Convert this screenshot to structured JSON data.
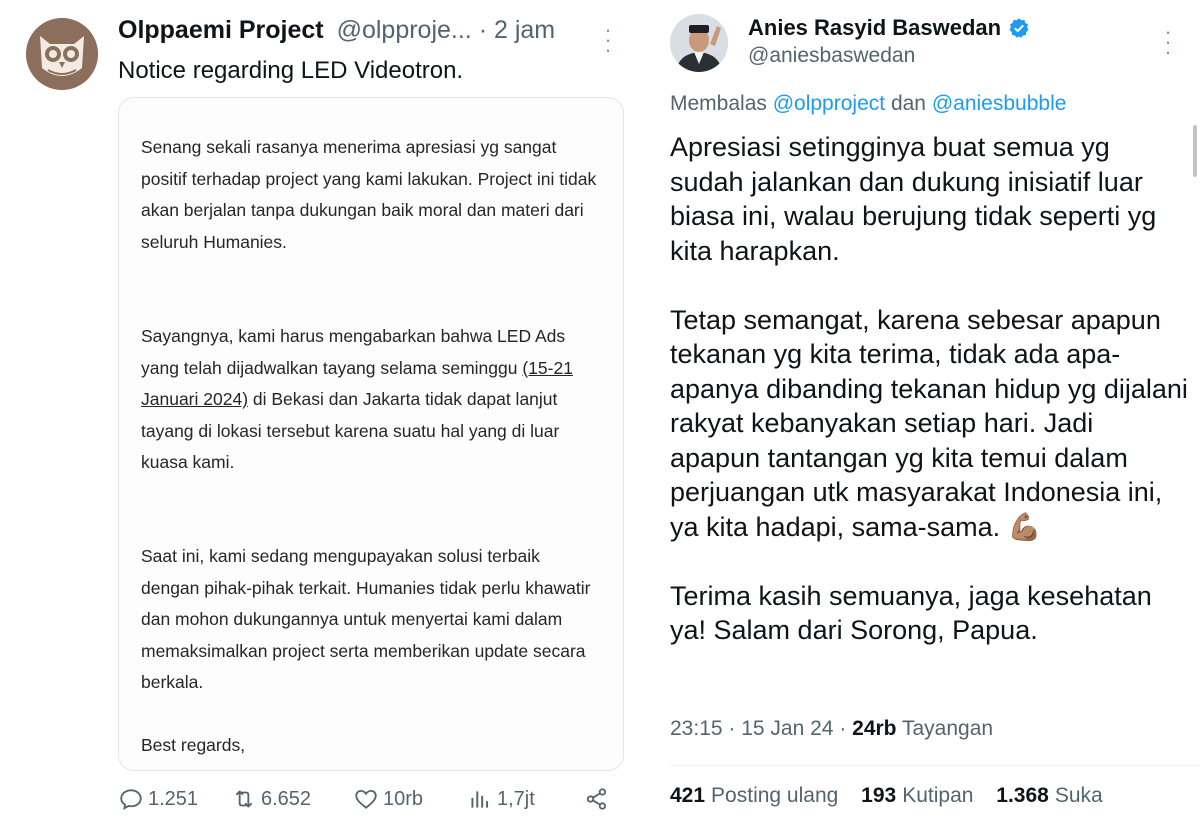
{
  "left_tweet": {
    "author_name": "Olppaemi Project",
    "handle": "@olpproje...",
    "time": "· 2 jam",
    "text": "Notice regarding LED Videotron.",
    "card": {
      "p1": "Senang sekali rasanya menerima apresiasi yg sangat positif terhadap project yang kami lakukan. Project ini tidak akan berjalan tanpa dukungan baik moral dan materi dari seluruh Humanies.",
      "p2_before": "Sayangnya, kami harus mengabarkan bahwa LED Ads yang telah dijadwalkan tayang selama seminggu ",
      "p2_date": "(15-21 Januari 2024)",
      "p2_after": " di Bekasi dan Jakarta tidak dapat lanjut tayang di lokasi tersebut karena suatu hal yang di luar kuasa kami.",
      "p3": "Saat ini, kami sedang mengupayakan solusi terbaik dengan pihak-pihak terkait. Humanies tidak perlu khawatir dan mohon dukungannya untuk menyertai kami dalam memaksimalkan project serta memberikan update secara berkala.",
      "p4": "Best regards,"
    },
    "actions": {
      "replies": "1.251",
      "reposts": "6.652",
      "likes": "10rb",
      "views": "1,7jt"
    }
  },
  "right_tweet": {
    "author_name": "Anies Rasyid Baswedan",
    "handle": "@aniesbaswedan",
    "reply_prefix": "Membalas",
    "reply_mention_1": "@olpproject",
    "reply_joiner": "dan",
    "reply_mention_2": "@aniesbubble",
    "body": [
      "Apresiasi setingginya buat semua yg sudah jalankan dan dukung inisiatif luar biasa ini, walau berujung tidak seperti yg kita harapkan.",
      "Tetap semangat, karena sebesar apapun tekanan yg kita terima, tidak ada apa-apanya dibanding tekanan hidup yg dijalani rakyat kebanyakan setiap hari. Jadi apapun tantangan yg kita temui dalam perjuangan utk masyarakat Indonesia ini, ya kita hadapi, sama-sama. 💪🏽",
      "Terima kasih semuanya, jaga kesehatan ya! Salam dari Sorong, Papua."
    ],
    "time": "23:15",
    "date": "15 Jan 24",
    "views_count": "24rb",
    "views_label": "Tayangan",
    "reposts_count": "421",
    "reposts_label": "Posting ulang",
    "quotes_count": "193",
    "quotes_label": "Kutipan",
    "likes_count": "1.368",
    "likes_label": "Suka"
  },
  "colors": {
    "text": "#0f1419",
    "muted": "#536471",
    "link": "#1d9bf0",
    "verified": "#1d9bf0",
    "owl_avatar": "#8b6f5c"
  },
  "icons": [
    "owl-logo-avatar",
    "more-icon",
    "reply-icon",
    "repost-icon",
    "like-icon",
    "views-icon",
    "share-icon",
    "verified-badge-icon",
    "profile-photo-avatar"
  ]
}
